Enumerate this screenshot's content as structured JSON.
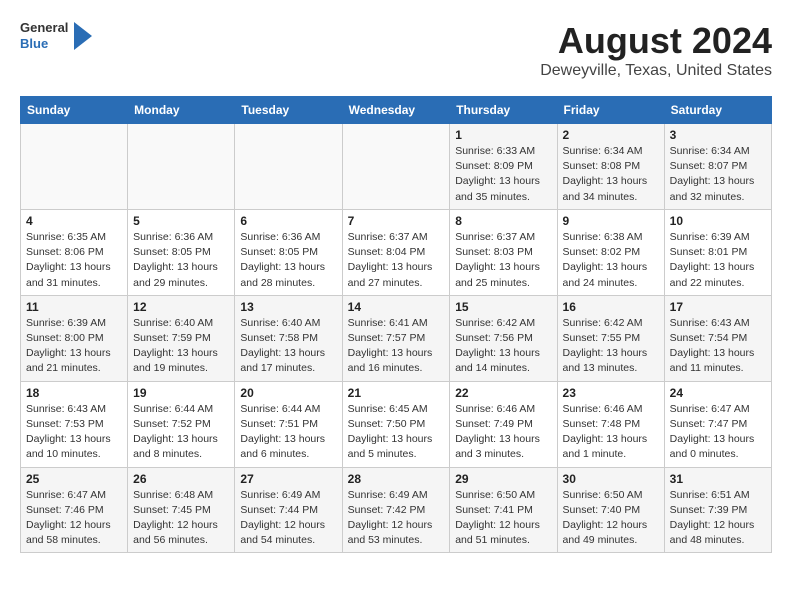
{
  "header": {
    "logo": {
      "line1": "General",
      "line2": "Blue"
    },
    "title": "August 2024",
    "location": "Deweyville, Texas, United States"
  },
  "weekdays": [
    "Sunday",
    "Monday",
    "Tuesday",
    "Wednesday",
    "Thursday",
    "Friday",
    "Saturday"
  ],
  "weeks": [
    [
      {
        "day": "",
        "info": ""
      },
      {
        "day": "",
        "info": ""
      },
      {
        "day": "",
        "info": ""
      },
      {
        "day": "",
        "info": ""
      },
      {
        "day": "1",
        "info": "Sunrise: 6:33 AM\nSunset: 8:09 PM\nDaylight: 13 hours\nand 35 minutes."
      },
      {
        "day": "2",
        "info": "Sunrise: 6:34 AM\nSunset: 8:08 PM\nDaylight: 13 hours\nand 34 minutes."
      },
      {
        "day": "3",
        "info": "Sunrise: 6:34 AM\nSunset: 8:07 PM\nDaylight: 13 hours\nand 32 minutes."
      }
    ],
    [
      {
        "day": "4",
        "info": "Sunrise: 6:35 AM\nSunset: 8:06 PM\nDaylight: 13 hours\nand 31 minutes."
      },
      {
        "day": "5",
        "info": "Sunrise: 6:36 AM\nSunset: 8:05 PM\nDaylight: 13 hours\nand 29 minutes."
      },
      {
        "day": "6",
        "info": "Sunrise: 6:36 AM\nSunset: 8:05 PM\nDaylight: 13 hours\nand 28 minutes."
      },
      {
        "day": "7",
        "info": "Sunrise: 6:37 AM\nSunset: 8:04 PM\nDaylight: 13 hours\nand 27 minutes."
      },
      {
        "day": "8",
        "info": "Sunrise: 6:37 AM\nSunset: 8:03 PM\nDaylight: 13 hours\nand 25 minutes."
      },
      {
        "day": "9",
        "info": "Sunrise: 6:38 AM\nSunset: 8:02 PM\nDaylight: 13 hours\nand 24 minutes."
      },
      {
        "day": "10",
        "info": "Sunrise: 6:39 AM\nSunset: 8:01 PM\nDaylight: 13 hours\nand 22 minutes."
      }
    ],
    [
      {
        "day": "11",
        "info": "Sunrise: 6:39 AM\nSunset: 8:00 PM\nDaylight: 13 hours\nand 21 minutes."
      },
      {
        "day": "12",
        "info": "Sunrise: 6:40 AM\nSunset: 7:59 PM\nDaylight: 13 hours\nand 19 minutes."
      },
      {
        "day": "13",
        "info": "Sunrise: 6:40 AM\nSunset: 7:58 PM\nDaylight: 13 hours\nand 17 minutes."
      },
      {
        "day": "14",
        "info": "Sunrise: 6:41 AM\nSunset: 7:57 PM\nDaylight: 13 hours\nand 16 minutes."
      },
      {
        "day": "15",
        "info": "Sunrise: 6:42 AM\nSunset: 7:56 PM\nDaylight: 13 hours\nand 14 minutes."
      },
      {
        "day": "16",
        "info": "Sunrise: 6:42 AM\nSunset: 7:55 PM\nDaylight: 13 hours\nand 13 minutes."
      },
      {
        "day": "17",
        "info": "Sunrise: 6:43 AM\nSunset: 7:54 PM\nDaylight: 13 hours\nand 11 minutes."
      }
    ],
    [
      {
        "day": "18",
        "info": "Sunrise: 6:43 AM\nSunset: 7:53 PM\nDaylight: 13 hours\nand 10 minutes."
      },
      {
        "day": "19",
        "info": "Sunrise: 6:44 AM\nSunset: 7:52 PM\nDaylight: 13 hours\nand 8 minutes."
      },
      {
        "day": "20",
        "info": "Sunrise: 6:44 AM\nSunset: 7:51 PM\nDaylight: 13 hours\nand 6 minutes."
      },
      {
        "day": "21",
        "info": "Sunrise: 6:45 AM\nSunset: 7:50 PM\nDaylight: 13 hours\nand 5 minutes."
      },
      {
        "day": "22",
        "info": "Sunrise: 6:46 AM\nSunset: 7:49 PM\nDaylight: 13 hours\nand 3 minutes."
      },
      {
        "day": "23",
        "info": "Sunrise: 6:46 AM\nSunset: 7:48 PM\nDaylight: 13 hours\nand 1 minute."
      },
      {
        "day": "24",
        "info": "Sunrise: 6:47 AM\nSunset: 7:47 PM\nDaylight: 13 hours\nand 0 minutes."
      }
    ],
    [
      {
        "day": "25",
        "info": "Sunrise: 6:47 AM\nSunset: 7:46 PM\nDaylight: 12 hours\nand 58 minutes."
      },
      {
        "day": "26",
        "info": "Sunrise: 6:48 AM\nSunset: 7:45 PM\nDaylight: 12 hours\nand 56 minutes."
      },
      {
        "day": "27",
        "info": "Sunrise: 6:49 AM\nSunset: 7:44 PM\nDaylight: 12 hours\nand 54 minutes."
      },
      {
        "day": "28",
        "info": "Sunrise: 6:49 AM\nSunset: 7:42 PM\nDaylight: 12 hours\nand 53 minutes."
      },
      {
        "day": "29",
        "info": "Sunrise: 6:50 AM\nSunset: 7:41 PM\nDaylight: 12 hours\nand 51 minutes."
      },
      {
        "day": "30",
        "info": "Sunrise: 6:50 AM\nSunset: 7:40 PM\nDaylight: 12 hours\nand 49 minutes."
      },
      {
        "day": "31",
        "info": "Sunrise: 6:51 AM\nSunset: 7:39 PM\nDaylight: 12 hours\nand 48 minutes."
      }
    ]
  ]
}
